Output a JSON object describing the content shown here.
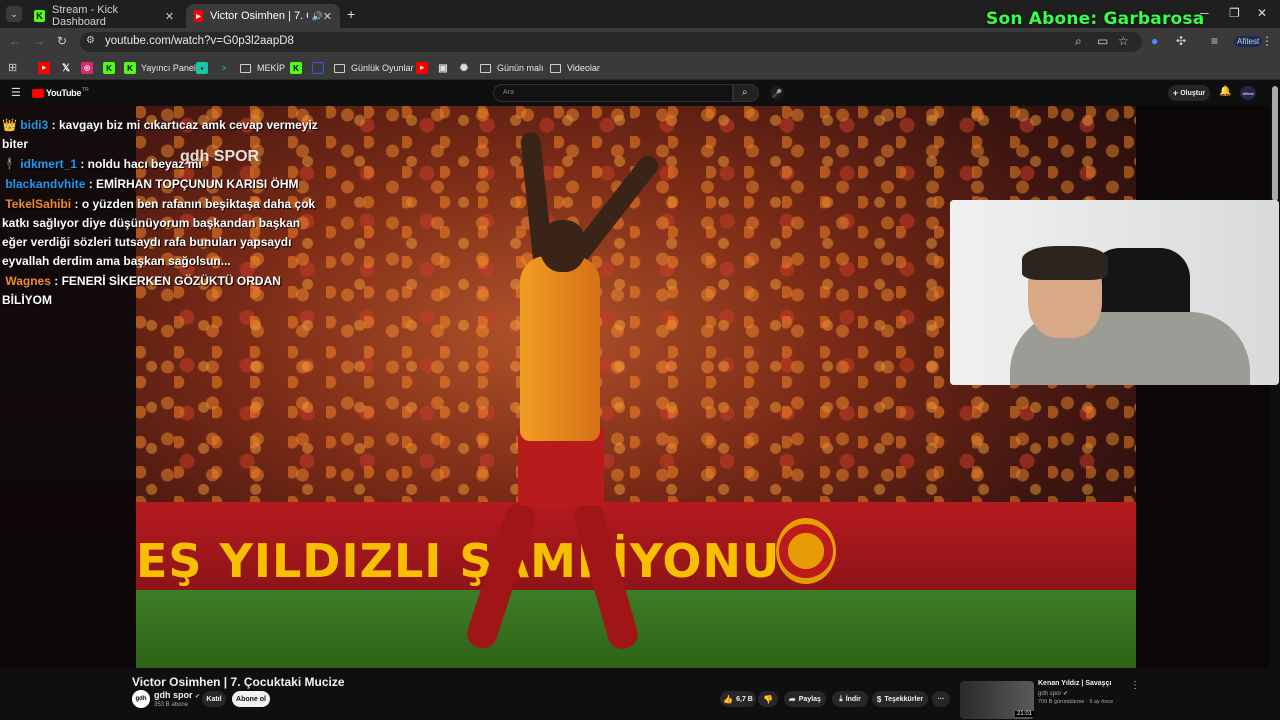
{
  "browser": {
    "tabs": [
      {
        "title": "Stream - Kick Dashboard",
        "favicon": "K",
        "active": false
      },
      {
        "title": "Victor Osimhen | 7. Çocukt",
        "favicon": "▶",
        "active": true
      }
    ],
    "new_tab_label": "+",
    "url": "youtube.com/watch?v=G0p3l2aapD8"
  },
  "overlay": {
    "son_abone": "Son Abone: Garbarosa"
  },
  "bookmarks": [
    {
      "label": "",
      "icon": "youtube-icon"
    },
    {
      "label": "",
      "icon": "x-icon"
    },
    {
      "label": "",
      "icon": "instagram-icon"
    },
    {
      "label": "",
      "icon": "kick-icon"
    },
    {
      "label": "Yayıncı Paneli",
      "icon": "kick-icon"
    },
    {
      "label": "",
      "icon": "app-icon"
    },
    {
      "label": "",
      "icon": "prime-icon"
    },
    {
      "label": "MEKİP",
      "icon": "folder-icon"
    },
    {
      "label": "",
      "icon": "kick-icon"
    },
    {
      "label": "",
      "icon": "square-icon"
    },
    {
      "label": "Günlük Oyunlar",
      "icon": "folder-icon"
    },
    {
      "label": "",
      "icon": "youtube-icon"
    },
    {
      "label": "",
      "icon": "gallery-icon"
    },
    {
      "label": "",
      "icon": "chatgpt-icon"
    },
    {
      "label": "Günün malı",
      "icon": "folder-icon"
    },
    {
      "label": "Videolar",
      "icon": "folder-icon"
    }
  ],
  "youtube": {
    "logo": "YouTube",
    "logo_sup": "TR",
    "search_placeholder": "Ara",
    "create_label": "Oluştur",
    "avatar_label": "Afitest"
  },
  "video": {
    "watermark": "gdh SPOR",
    "board_text": "EŞ YILDIZLI ŞAMPİYONU",
    "title": "Victor Osimhen | 7. Çocuktaki Mucize",
    "channel": "gdh spor",
    "subs": "353 B abone",
    "join_label": "Katıl",
    "subscribe_label": "Abone ol",
    "likes": "6,7 B",
    "share_label": "Paylaş",
    "download_label": "İndir",
    "thanks_label": "Teşekkürler",
    "more": "···"
  },
  "chat": [
    {
      "user": "bidi3",
      "badge": "crown",
      "text": ": kavgayı biz mi cıkartıcaz amk cevap vermeyiz biter"
    },
    {
      "user": "idkmert_1",
      "badge": "figure",
      "text": ": noldu hacı beyaz mı"
    },
    {
      "user": "blackandvhite",
      "badge": "",
      "text": ": EMİRHAN TOPÇUNUN KARISI ÖHM"
    },
    {
      "user": "TekelSahibi",
      "badge": "",
      "text": ": o yüzden ben rafanın beşiktaşa daha çok katkı sağlıyor diye düşünüyorum başkandan başkan eğer verdiği sözleri tutsaydı rafa bunuları yapsaydı eyvallah derdim ama başkan sağolsun..."
    },
    {
      "user": "Wagnes",
      "badge": "",
      "text": ": FENERİ SİKERKEN GÖZÜKTÜ ORDAN BİLİYOM"
    }
  ],
  "related": {
    "title": "Kenan Yıldız | Savaşçı",
    "channel": "gdh spor",
    "meta": "709 B görüntüleme · 9 ay önce",
    "duration": "21:01"
  },
  "colors": {
    "accent_green": "#38ff4a",
    "chat_user": "#1d9bf0"
  }
}
